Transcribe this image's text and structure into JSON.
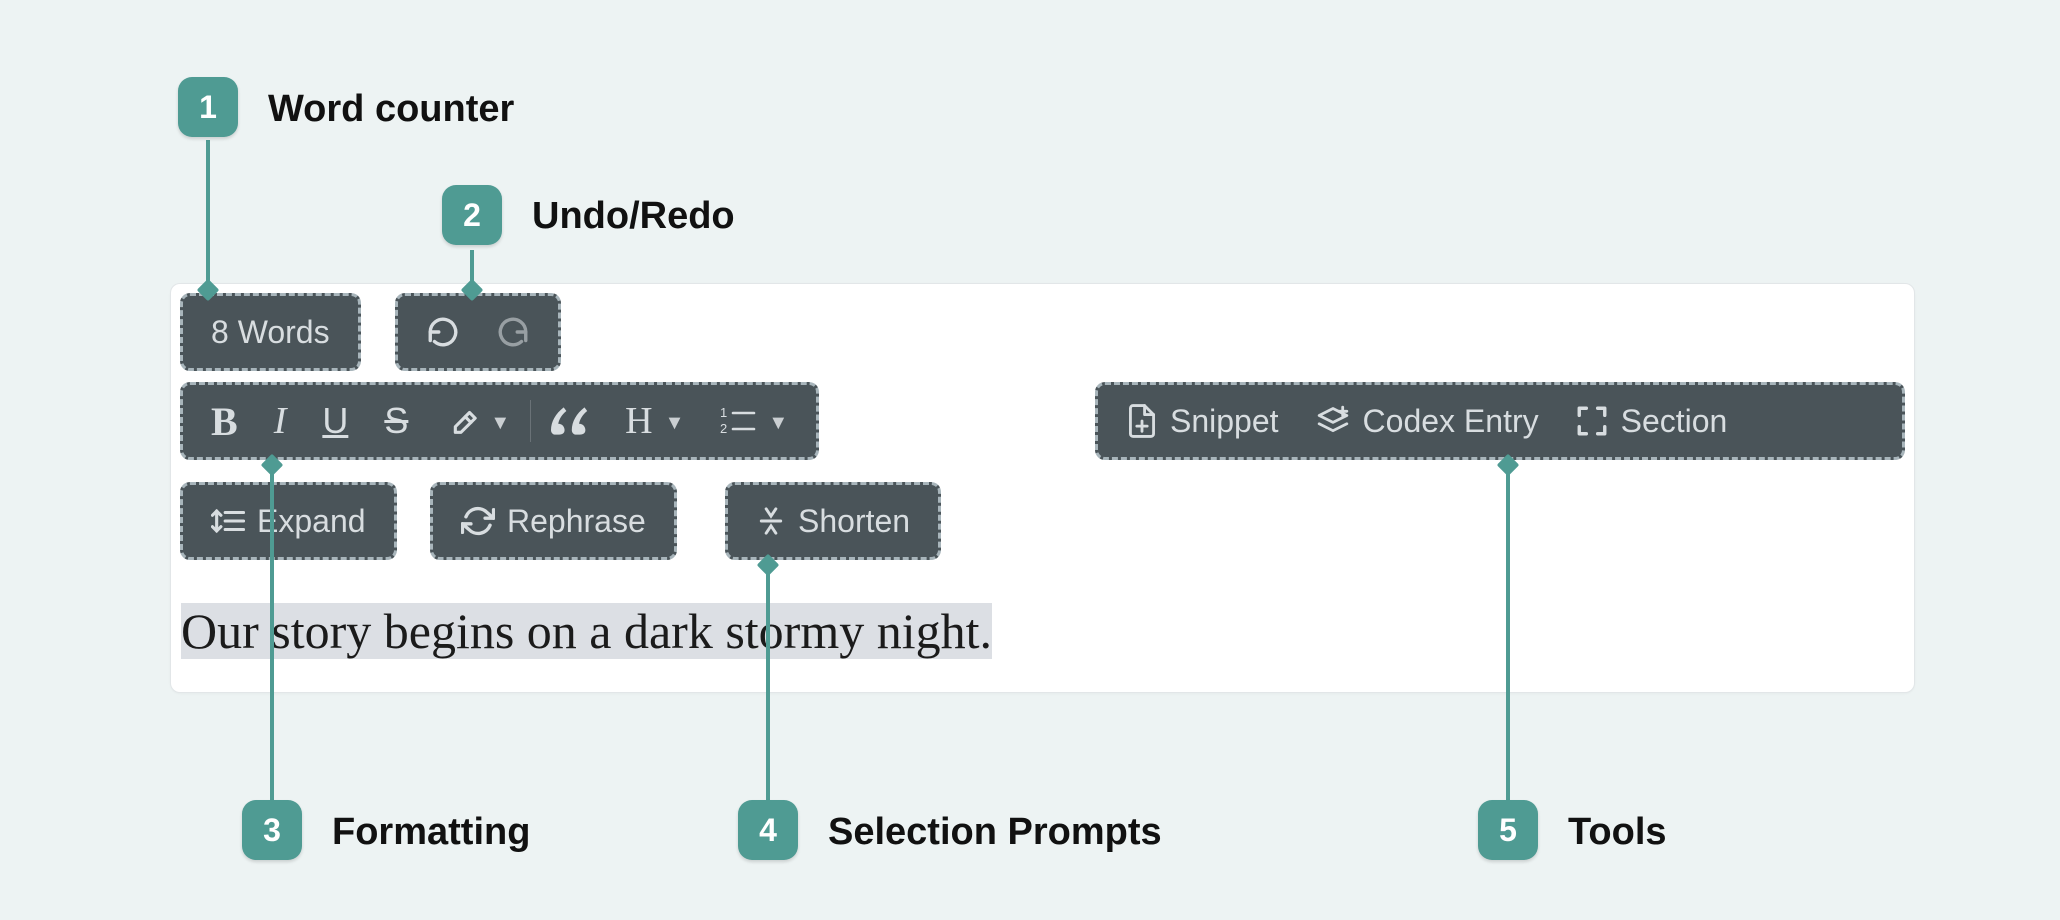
{
  "callouts": {
    "c1": {
      "num": "1",
      "label": "Word counter"
    },
    "c2": {
      "num": "2",
      "label": "Undo/Redo"
    },
    "c3": {
      "num": "3",
      "label": "Formatting"
    },
    "c4": {
      "num": "4",
      "label": "Selection Prompts"
    },
    "c5": {
      "num": "5",
      "label": "Tools"
    }
  },
  "toolbar": {
    "word_count": "8 Words",
    "expand_label": "Expand",
    "rephrase_label": "Rephrase",
    "shorten_label": "Shorten",
    "snippet_label": "Snippet",
    "codex_label": "Codex Entry",
    "section_label": "Section",
    "heading_letter": "H",
    "list_glyph": "",
    "quote_glyph": ""
  },
  "editor": {
    "text": "Our story begins on a dark stormy night."
  }
}
